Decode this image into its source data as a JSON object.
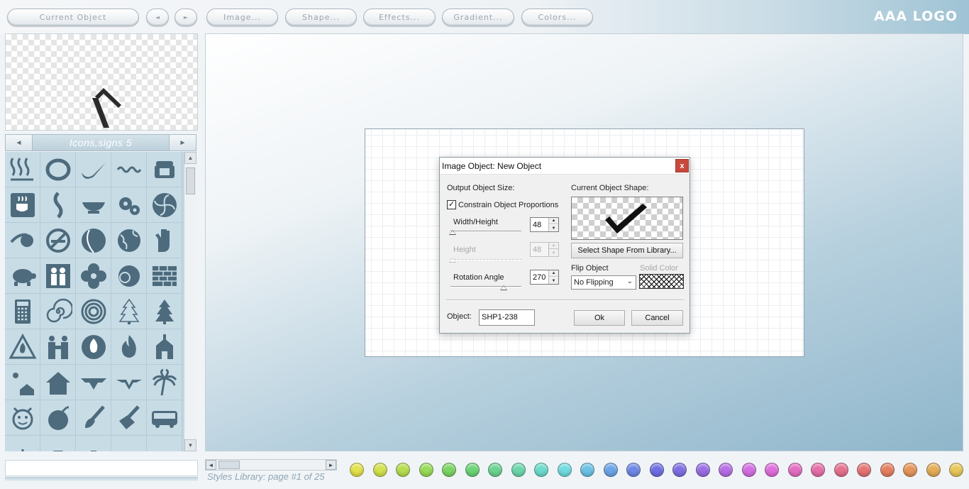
{
  "toolbar": {
    "current_object": "Current Object",
    "prev": "◄",
    "next": "►",
    "image": "Image...",
    "shape": "Shape...",
    "effects": "Effects...",
    "gradient": "Gradient...",
    "colors": "Colors...",
    "logo": "AAA LOGO"
  },
  "library": {
    "title": "Icons,signs 5",
    "prev": "◄",
    "next": "►",
    "icons": [
      "steam-waves-icon",
      "swirl-ring-icon",
      "swoosh-icon",
      "wave-line-icon",
      "telephone-icon",
      "coffee-cup-icon",
      "s-curve-icon",
      "gravy-boat-icon",
      "gears-icon",
      "fan-icon",
      "comet-icon",
      "no-smoking-icon",
      "moon-face-icon",
      "globe-icon",
      "hand-icon",
      "turtle-icon",
      "family-icon",
      "flower-icon",
      "lion-icon",
      "brick-wall-icon",
      "calculator-icon",
      "spiral-icon",
      "spiral-circle-icon",
      "pine-tree-outline-icon",
      "pine-tree-icon",
      "warning-fire-icon",
      "handshake-icon",
      "fire-circle-icon",
      "flame-icon",
      "chapel-icon",
      "sun-house-icon",
      "house-icon",
      "winged-emblem-icon",
      "wings-icon",
      "palm-tree-icon",
      "smiley-pin-icon",
      "bomb-icon",
      "paint-brush-icon",
      "trowel-icon",
      "bus-icon",
      "cross-icon",
      "cup-icon",
      "bottle-icon",
      "ellipse-icon",
      "blank-icon"
    ]
  },
  "dialog": {
    "title": "Image Object: New Object",
    "close": "x",
    "output_size_label": "Output Object Size:",
    "constrain_label": "Constrain Object Proportions",
    "constrain_checked": "✓",
    "width_height_label": "Width/Height",
    "width_height_value": "48",
    "height_label": "Height",
    "height_value": "48",
    "rotation_label": "Rotation Angle",
    "rotation_value": "270",
    "current_shape_label": "Current Object Shape:",
    "select_shape_button": "Select Shape From Library...",
    "flip_label": "Flip Object",
    "flip_value": "No Flipping",
    "solid_color_label": "Solid Color",
    "object_label": "Object:",
    "object_value": "SHP1-238",
    "ok": "Ok",
    "cancel": "Cancel",
    "spin_up": "▲",
    "spin_down": "▼",
    "dropdown_arrow": "⌄"
  },
  "footer": {
    "styles_page": "Styles Library: page #1 of 25",
    "scroll_left": "◄",
    "scroll_right": "►"
  },
  "palette": [
    "#e4e24a",
    "#d2e24c",
    "#b5de50",
    "#99dc58",
    "#7cd664",
    "#6bd577",
    "#6bd590",
    "#6bd8ac",
    "#6bdccd",
    "#70dde2",
    "#6cc3e6",
    "#6ba5e7",
    "#6d88e6",
    "#6f6fe5",
    "#7f6ee4",
    "#9a6ee5",
    "#b86ee4",
    "#d46ee3",
    "#e06edb",
    "#e46ec2",
    "#e66ea9",
    "#e6718f",
    "#e67475",
    "#e67f62",
    "#e6965a",
    "#e5ad55",
    "#e8c85a"
  ]
}
